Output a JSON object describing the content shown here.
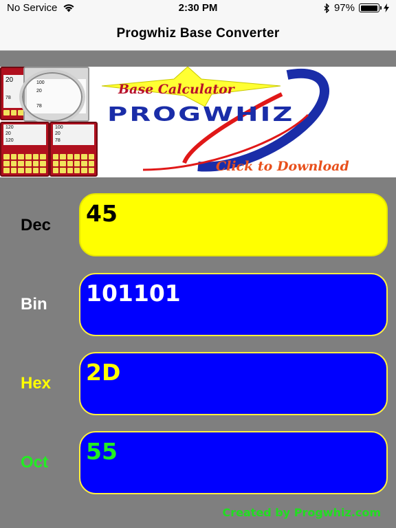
{
  "status_bar": {
    "carrier": "No Service",
    "time": "2:30 PM",
    "battery_percent": "97%",
    "battery_level": 0.97,
    "icons": [
      "wifi-icon",
      "bluetooth-icon",
      "battery-icon",
      "charging-icon"
    ]
  },
  "nav": {
    "title": "Progwhiz Base Converter"
  },
  "banner": {
    "subtitle": "Base Calculator",
    "brand": "ProgWhiz",
    "cta": "Click to Download",
    "mini_calc_values": [
      "20",
      "100",
      "20",
      "78",
      "120",
      "20",
      "120",
      "100",
      "20",
      "78"
    ]
  },
  "converter": {
    "rows": [
      {
        "label": "Dec",
        "value": "45",
        "label_color": "#000000",
        "value_color": "#000000",
        "field_color": "#ffff00"
      },
      {
        "label": "Bin",
        "value": "101101",
        "label_color": "#ffffff",
        "value_color": "#ffffff",
        "field_color": "#0000ff"
      },
      {
        "label": "Hex",
        "value": "2D",
        "label_color": "#ffff00",
        "value_color": "#ffff00",
        "field_color": "#0000ff"
      },
      {
        "label": "Oct",
        "value": "55",
        "label_color": "#22ee22",
        "value_color": "#22ee22",
        "field_color": "#0000ff"
      }
    ]
  },
  "footer": {
    "credit": "Created by Progwhiz.com"
  }
}
